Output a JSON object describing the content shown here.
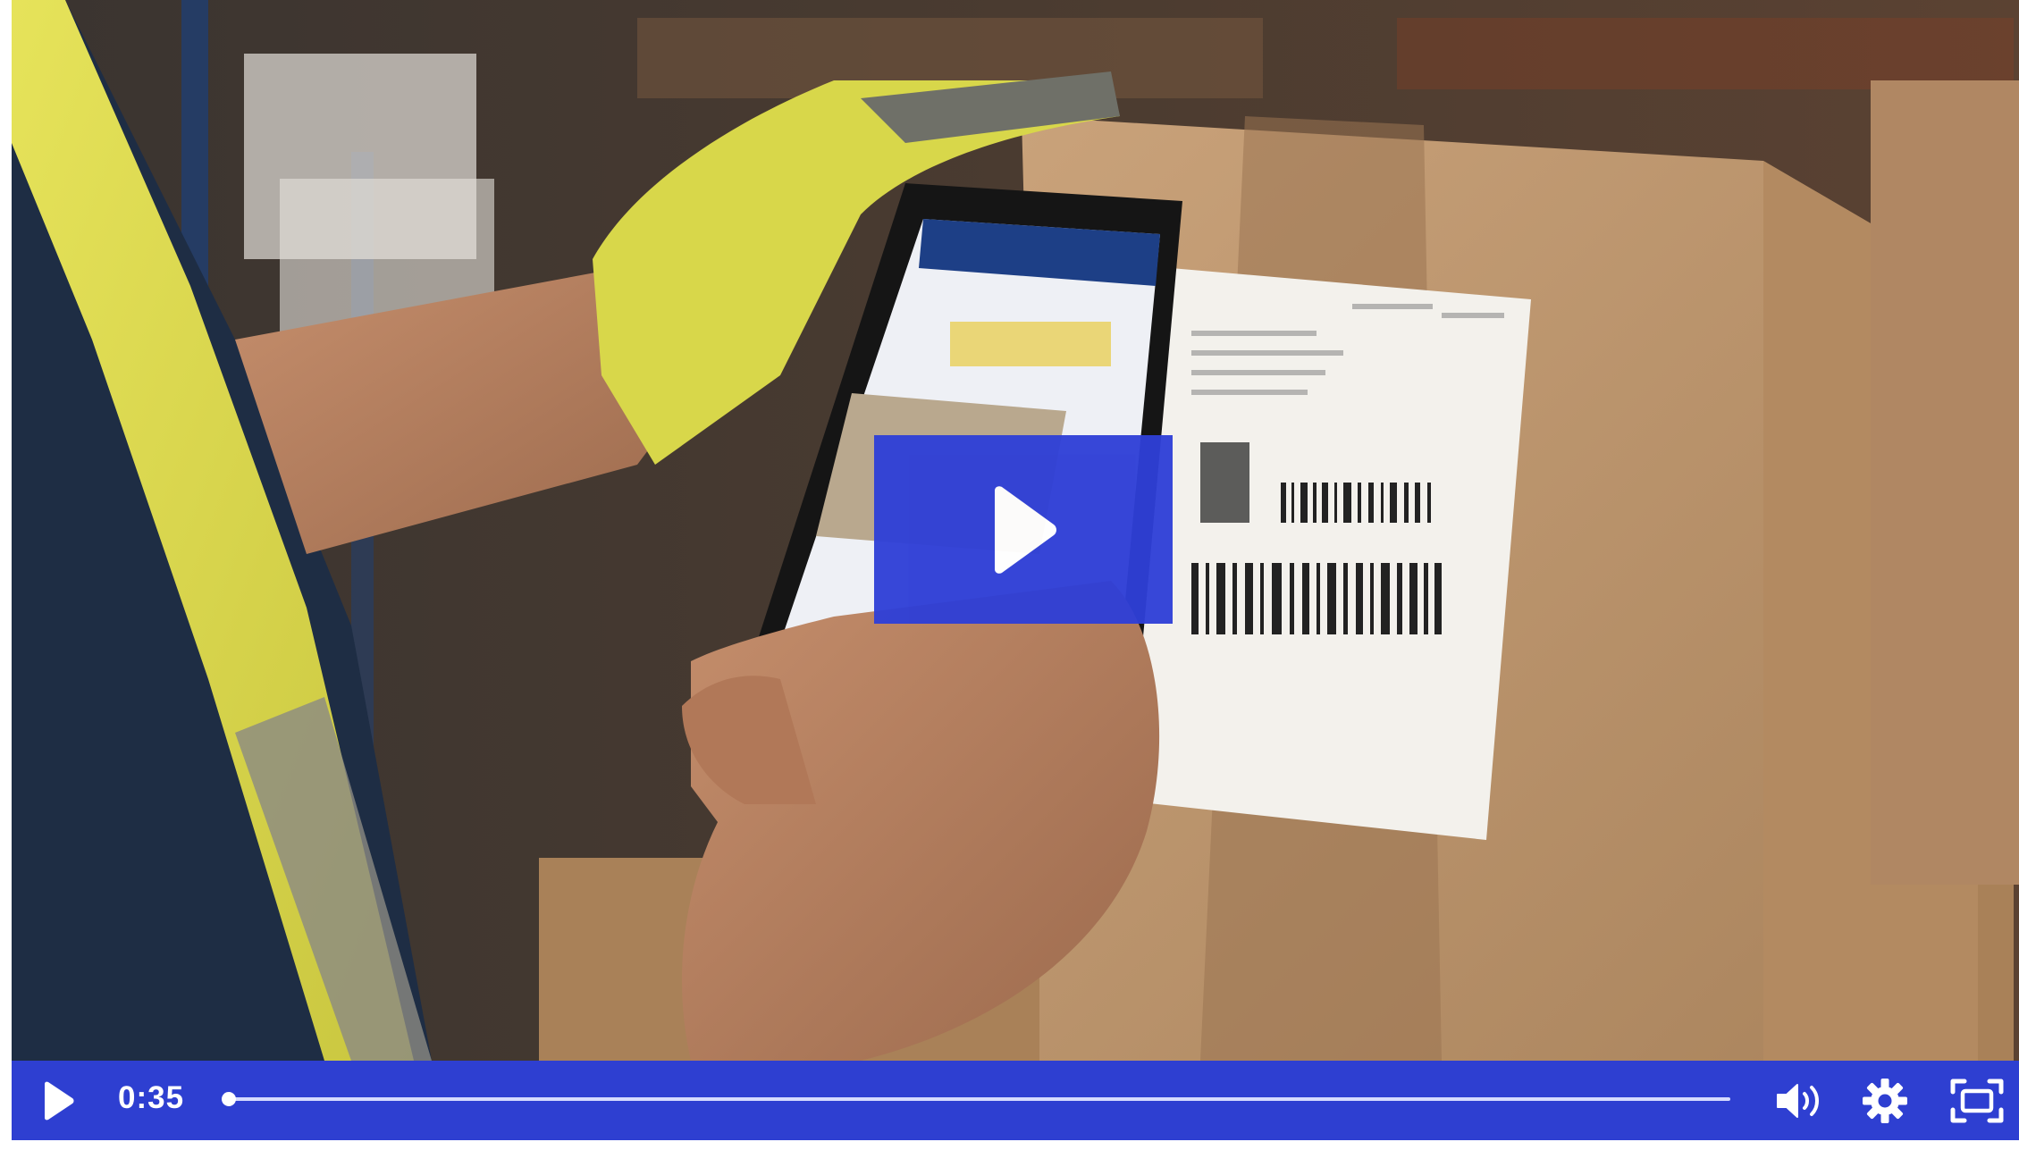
{
  "player": {
    "current_time": "0:35",
    "progress": 0.0,
    "accent_color": "#2e3fd1",
    "icons": {
      "big_play": "play-icon",
      "play": "play-icon",
      "volume": "volume-icon",
      "settings": "gear-icon",
      "fullscreen": "fullscreen-icon"
    }
  }
}
